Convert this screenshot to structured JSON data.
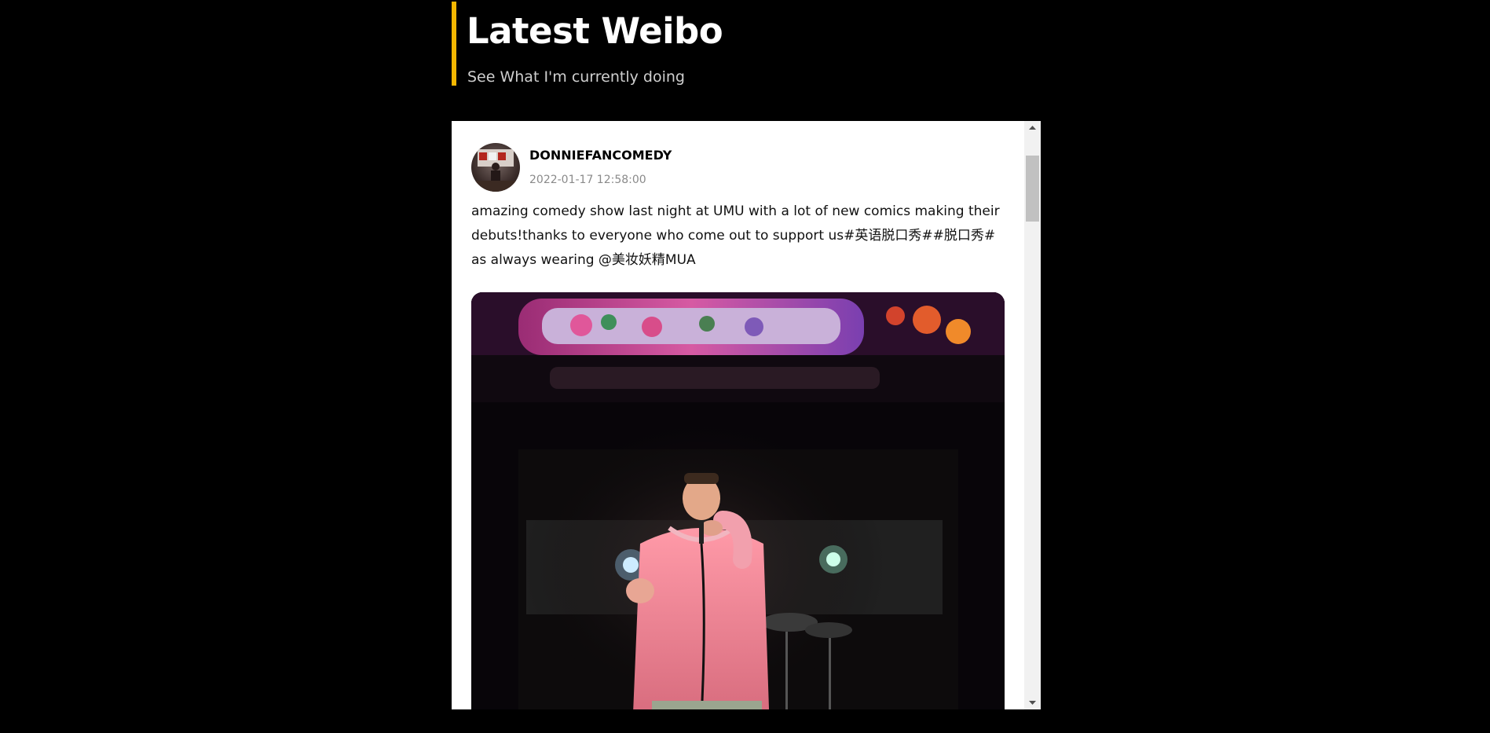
{
  "header": {
    "title": "Latest Weibo",
    "subtitle": "See What I'm currently doing",
    "accent_color": "#f5b700"
  },
  "feed": {
    "scroll_position": 0.05,
    "posts": [
      {
        "author": "DONNIEFANCOMEDY",
        "timestamp": "2022-01-17 12:58:00",
        "text": "amazing comedy show last night at UMU with a lot of new comics making their debuts!thanks to everyone who come out to support us#英语脱口秀##脱口秀# as always wearing @美妆妖精MUA",
        "avatar_icon": "avatar",
        "image_icon": "comedian-on-stage-photo"
      }
    ]
  }
}
